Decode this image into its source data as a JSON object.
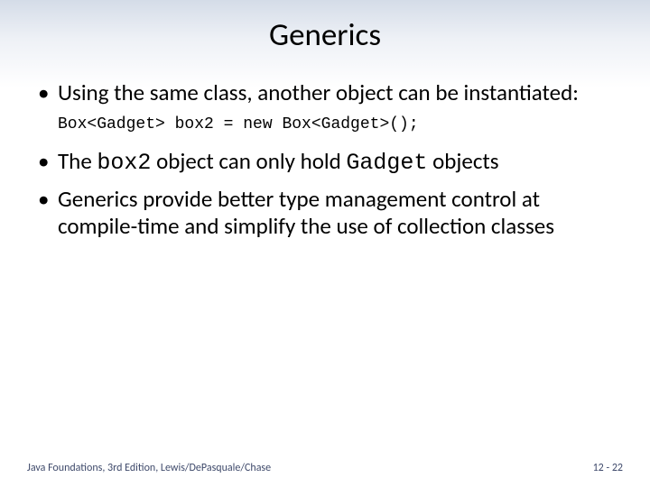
{
  "title": "Generics",
  "bullets": {
    "b1": "Using the same class, another object can be instantiated:",
    "code1": "Box<Gadget> box2 = new Box<Gadget>();",
    "b2_pre": "The ",
    "b2_code1": "box2",
    "b2_mid": " object can only hold ",
    "b2_code2": "Gadget",
    "b2_post": " objects",
    "b3": "Generics provide better type management control at compile-time and simplify the use of collection classes"
  },
  "footer": {
    "left": "Java Foundations, 3rd Edition, Lewis/DePasquale/Chase",
    "right": "12 - 22"
  }
}
